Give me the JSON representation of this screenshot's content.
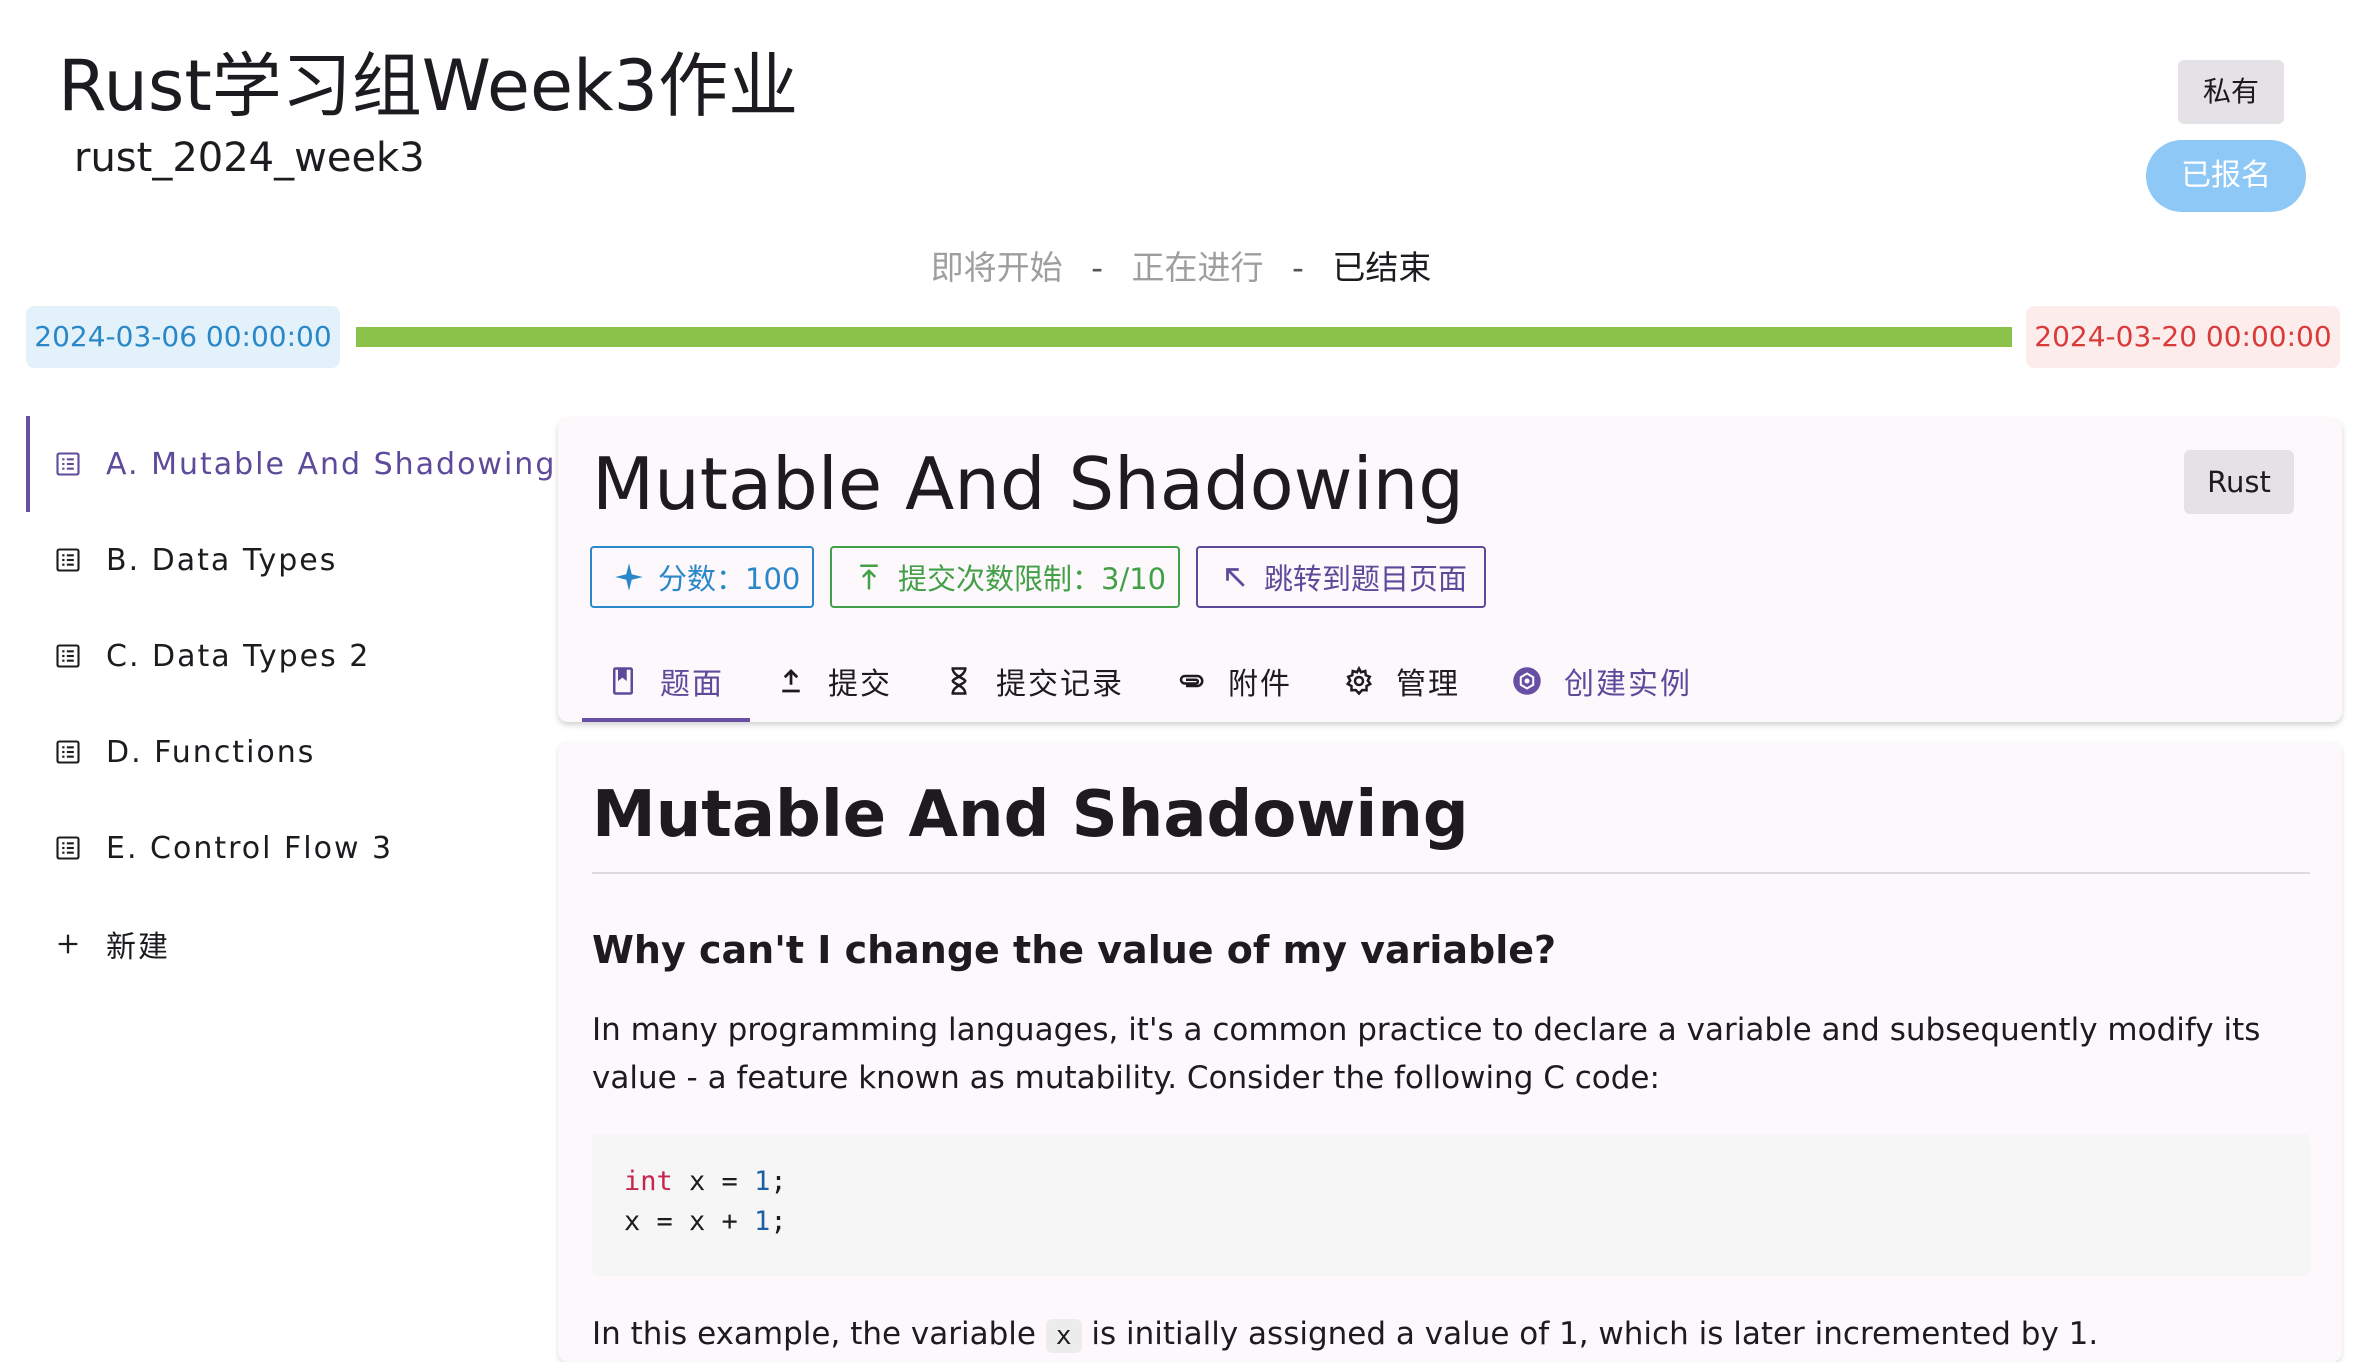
{
  "header": {
    "title": "Rust学习组Week3作业",
    "subtitle": "rust_2024_week3",
    "visibility_badge": "私有",
    "register_button": "已报名"
  },
  "status": {
    "upcoming": "即将开始",
    "ongoing": "正在进行",
    "ended": "已结束",
    "separator": "-",
    "current": "ended"
  },
  "timeline": {
    "start": "2024-03-06 00:00:00",
    "end": "2024-03-20 00:00:00",
    "progress_percent": 100
  },
  "sidebar": {
    "items": [
      {
        "label": "A. Mutable And Shadowing",
        "active": true,
        "icon": "list-icon"
      },
      {
        "label": "B. Data Types",
        "active": false,
        "icon": "list-icon"
      },
      {
        "label": "C. Data Types 2",
        "active": false,
        "icon": "list-icon"
      },
      {
        "label": "D. Functions",
        "active": false,
        "icon": "list-icon"
      },
      {
        "label": "E. Control Flow 3",
        "active": false,
        "icon": "list-icon"
      }
    ],
    "new_label": "新建"
  },
  "problem": {
    "title": "Mutable And Shadowing",
    "language": "Rust",
    "chips": {
      "score": "分数：100",
      "submit_limit": "提交次数限制：3/10",
      "jump": "跳转到题目页面"
    },
    "tabs": [
      {
        "label": "题面",
        "icon": "book-icon",
        "active": true
      },
      {
        "label": "提交",
        "icon": "upload-icon",
        "active": false
      },
      {
        "label": "提交记录",
        "icon": "hourglass-icon",
        "active": false
      },
      {
        "label": "附件",
        "icon": "paperclip-icon",
        "active": false
      },
      {
        "label": "管理",
        "icon": "gear-icon",
        "active": false
      },
      {
        "label": "创建实例",
        "icon": "instance-icon",
        "active": false
      }
    ]
  },
  "content": {
    "h1": "Mutable And Shadowing",
    "h2": "Why can't I change the value of my variable?",
    "p1": "In many programming languages, it's a common practice to declare a variable and subsequently modify its value - a feature known as mutability. Consider the following C code:",
    "code_lines": [
      {
        "kw": "int",
        "rest_a": " x = ",
        "num": "1",
        "rest_b": ";"
      },
      {
        "kw": "",
        "rest_a": "x = x + ",
        "num": "1",
        "rest_b": ";"
      }
    ],
    "p2_before": "In this example, the variable ",
    "p2_code": "x",
    "p2_after": " is initially assigned a value of 1, which is later incremented by 1."
  },
  "colors": {
    "accent": "#6750a4",
    "progress": "#8bc34a",
    "start_bg": "#e3f1fb",
    "end_bg": "#fdecec",
    "score_chip": "#2a88c9",
    "limit_chip": "#43a047"
  }
}
